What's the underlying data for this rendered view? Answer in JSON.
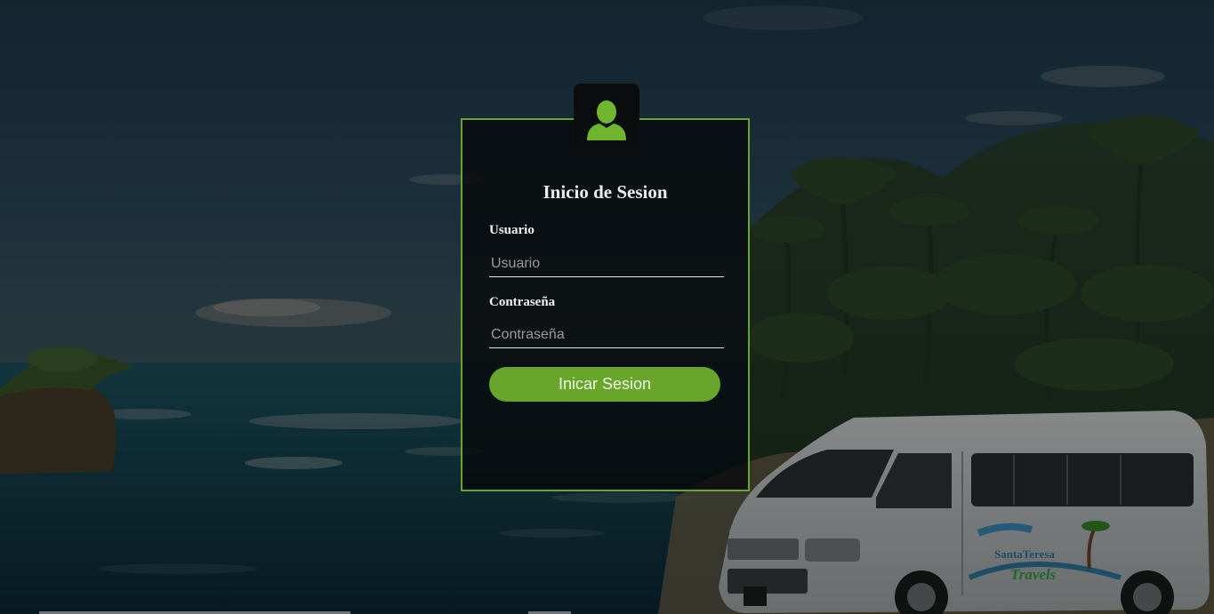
{
  "login": {
    "title": "Inicio de Sesion",
    "username_label": "Usuario",
    "username_placeholder": "Usuario",
    "username_value": "",
    "password_label": "Contraseña",
    "password_placeholder": "Contraseña",
    "password_value": "",
    "submit_label": "Inicar Sesion"
  },
  "branding": {
    "van_logo_line1": "SantaTeresa",
    "van_logo_line2": "Travels"
  },
  "icons": {
    "avatar": "user-icon"
  },
  "colors": {
    "accent": "#67a62a",
    "card_background": "#060809",
    "text": "#f0f0f0"
  }
}
